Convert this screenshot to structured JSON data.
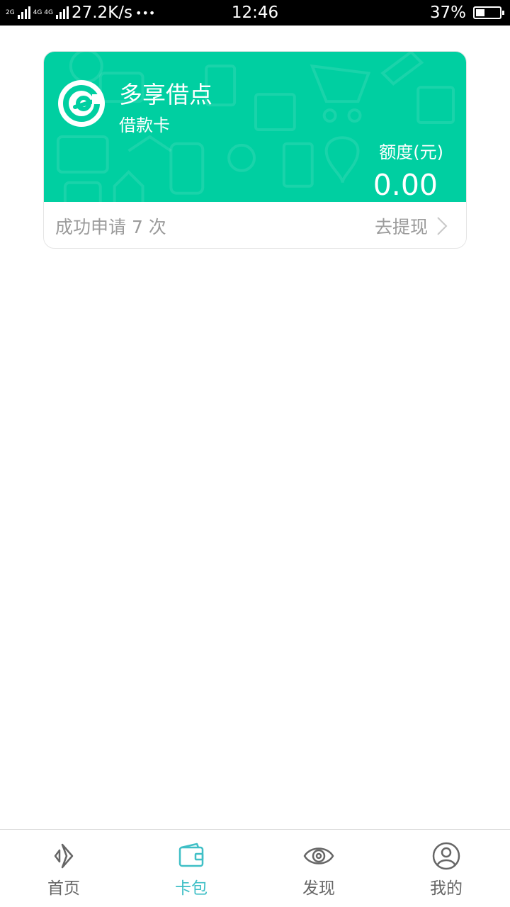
{
  "status_bar": {
    "net_top": "2G",
    "net_mid": "4G 4G",
    "speed": "27.2K/s",
    "dots": "•••",
    "time": "12:46",
    "battery_percent": "37%",
    "battery_level": 0.37
  },
  "card": {
    "name": "多享借点",
    "type": "借款卡",
    "limit_label": "额度(元)",
    "limit_value": "0.00",
    "apply_text": "成功申请 7 次",
    "withdraw_label": "去提现",
    "colors": {
      "accent": "#00cfa1"
    }
  },
  "tabbar": {
    "active_color": "#3fbfc6",
    "items": [
      {
        "label": "首页",
        "icon": "home-icon"
      },
      {
        "label": "卡包",
        "icon": "wallet-icon"
      },
      {
        "label": "发现",
        "icon": "eye-icon"
      },
      {
        "label": "我的",
        "icon": "user-icon"
      }
    ]
  }
}
